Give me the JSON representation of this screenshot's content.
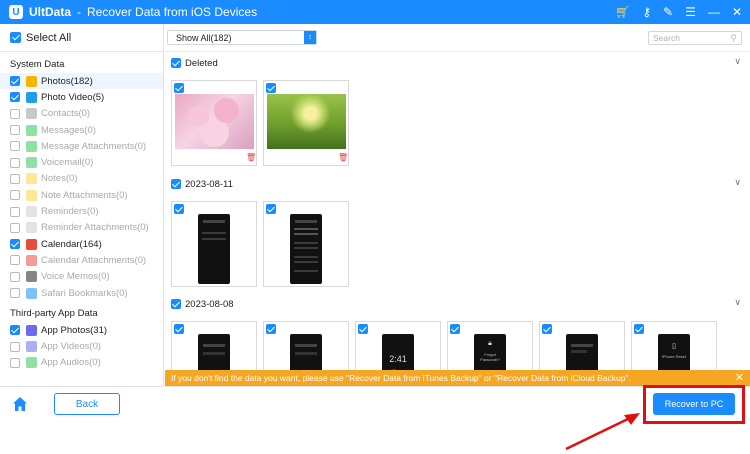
{
  "title_bar": {
    "app_name": "UltData",
    "separator": "-",
    "window_title": "Recover Data from iOS Devices",
    "icons": [
      "cart-icon",
      "key-icon",
      "pencil-icon",
      "menu-icon",
      "minimize-icon",
      "close-icon"
    ]
  },
  "sidebar": {
    "select_all_label": "Select All",
    "sections": [
      {
        "header": "System Data",
        "items": [
          {
            "label": "Photos(182)",
            "checked": true,
            "dim": false,
            "selected": true,
            "color": "#f7b500"
          },
          {
            "label": "Photo Video(5)",
            "checked": true,
            "dim": false,
            "selected": false,
            "color": "#1fa0e6"
          },
          {
            "label": "Contacts(0)",
            "checked": false,
            "dim": true,
            "selected": false,
            "color": "#9b9b9b"
          },
          {
            "label": "Messages(0)",
            "checked": false,
            "dim": true,
            "selected": false,
            "color": "#34c759"
          },
          {
            "label": "Message Attachments(0)",
            "checked": false,
            "dim": true,
            "selected": false,
            "color": "#34c759"
          },
          {
            "label": "Voicemail(0)",
            "checked": false,
            "dim": true,
            "selected": false,
            "color": "#34c759"
          },
          {
            "label": "Notes(0)",
            "checked": false,
            "dim": true,
            "selected": false,
            "color": "#f7d443"
          },
          {
            "label": "Note Attachments(0)",
            "checked": false,
            "dim": true,
            "selected": false,
            "color": "#f7d443"
          },
          {
            "label": "Reminders(0)",
            "checked": false,
            "dim": true,
            "selected": false,
            "color": "#cccccc"
          },
          {
            "label": "Reminder Attachments(0)",
            "checked": false,
            "dim": true,
            "selected": false,
            "color": "#cccccc"
          },
          {
            "label": "Calendar(164)",
            "checked": true,
            "dim": false,
            "selected": false,
            "color": "#e84a3c"
          },
          {
            "label": "Calendar Attachments(0)",
            "checked": false,
            "dim": true,
            "selected": false,
            "color": "#e84a3c"
          },
          {
            "label": "Voice Memos(0)",
            "checked": false,
            "dim": true,
            "selected": false,
            "color": "#222222"
          },
          {
            "label": "Safari Bookmarks(0)",
            "checked": false,
            "dim": true,
            "selected": false,
            "color": "#1a8cff"
          }
        ]
      },
      {
        "header": "Third-party App Data",
        "items": [
          {
            "label": "App Photos(31)",
            "checked": true,
            "dim": false,
            "selected": false,
            "color": "#6b6bf0"
          },
          {
            "label": "App Videos(0)",
            "checked": false,
            "dim": true,
            "selected": false,
            "color": "#6b6bf0"
          },
          {
            "label": "App Audios(0)",
            "checked": false,
            "dim": true,
            "selected": false,
            "color": "#34c759"
          }
        ]
      }
    ]
  },
  "toolbar": {
    "filter_value": "Show All(182)",
    "search_placeholder": "Search"
  },
  "groups": [
    {
      "label": "Deleted",
      "checked": true
    },
    {
      "label": "2023-08-11",
      "checked": true
    },
    {
      "label": "2023-08-08",
      "checked": true
    }
  ],
  "notice": {
    "text": "If you don't find the data you want, please use \"Recover Data from iTunes Backup\" or \"Recover Data from iCloud Backup\"."
  },
  "bottom": {
    "back_label": "Back",
    "recover_label": "Recover to PC"
  },
  "phone_texts": {
    "clock": "2:41",
    "unavailable": "iPhone Unavailable",
    "forgot": "Forgot Passcode?",
    "reset": "iPhone Reset"
  },
  "colors": {
    "accent": "#1a8cff",
    "notice": "#f5a623",
    "highlight": "#e01010"
  }
}
